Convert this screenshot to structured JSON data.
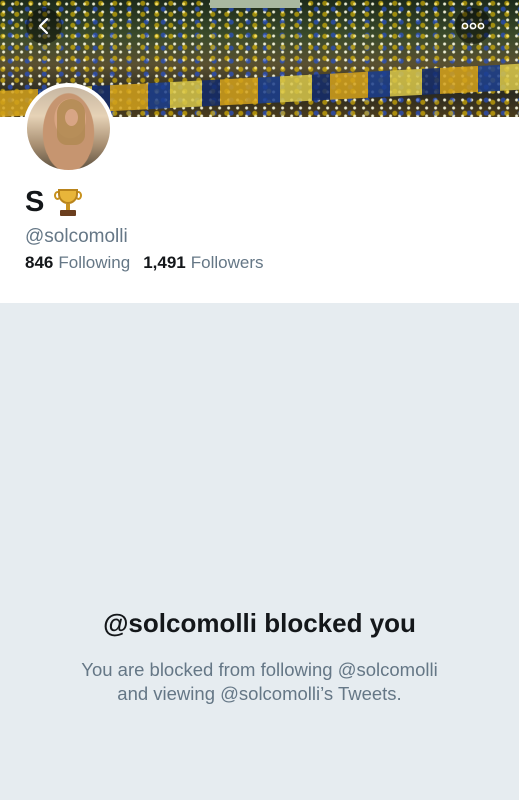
{
  "profile": {
    "display_name": "S",
    "display_emoji": "trophy-icon",
    "handle": "@solcomolli",
    "following_count": "846",
    "following_label": "Following",
    "followers_count": "1,491",
    "followers_label": "Followers"
  },
  "blocked": {
    "title": "@solcomolli blocked you",
    "line1": "You are blocked from following @solcomolli",
    "line2": "and viewing @solcomolli’s Tweets."
  },
  "icons": {
    "back": "chevron-left-icon",
    "more": "more-horizontal-icon"
  },
  "colors": {
    "background": "#e6ecf0",
    "primary_text": "#14171a",
    "secondary_text": "#657786"
  }
}
